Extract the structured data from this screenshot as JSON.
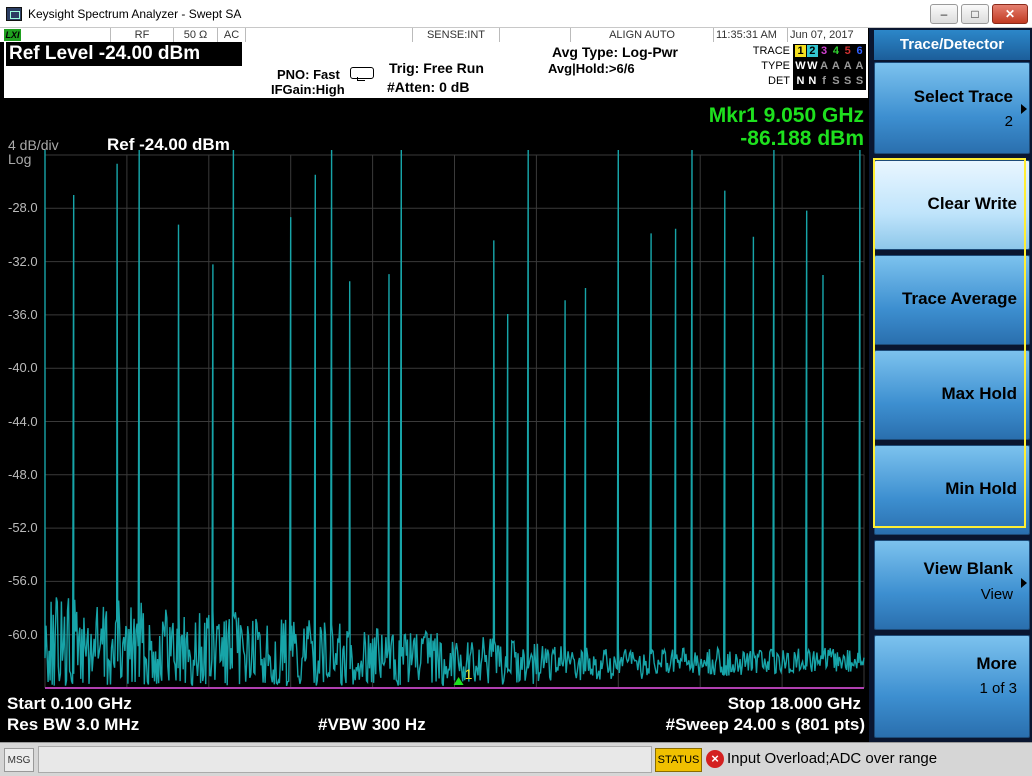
{
  "window": {
    "title": "Keysight Spectrum Analyzer - Swept SA",
    "min_glyph": "–",
    "max_glyph": "□",
    "close_glyph": "✕"
  },
  "status_row": {
    "lxi": "LXI",
    "rf": "RF",
    "impedance": "50 Ω",
    "coupling": "AC",
    "sense": "SENSE:INT",
    "align": "ALIGN AUTO",
    "time": "11:35:31 AM",
    "date": "Jun 07, 2017"
  },
  "header": {
    "ref_level": "Ref Level -24.00 dBm",
    "pno": "PNO: Fast",
    "ifgain": "IFGain:High",
    "trig": "Trig: Free Run",
    "atten": "#Atten: 0 dB",
    "avg_type": "Avg Type: Log-Pwr",
    "avg_hold": "Avg|Hold:>6/6",
    "trace_label": "TRACE",
    "type_label": "TYPE",
    "det_label": "DET",
    "trace_nums": [
      "1",
      "2",
      "3",
      "4",
      "5",
      "6"
    ],
    "trace_types": [
      "W",
      "W",
      "A",
      "A",
      "A",
      "A"
    ],
    "trace_dets": [
      "N",
      "N",
      "f",
      "S",
      "S",
      "S"
    ]
  },
  "marker": {
    "freq": "Mkr1 9.050 GHz",
    "amp": "-86.188 dBm",
    "label": "1"
  },
  "display": {
    "scale": "4 dB/div",
    "log": "Log",
    "ref": "Ref -24.00 dBm",
    "y_ticks": [
      "-28.0",
      "-32.0",
      "-36.0",
      "-40.0",
      "-44.0",
      "-48.0",
      "-52.0",
      "-56.0",
      "-60.0"
    ],
    "start": "Start 0.100 GHz",
    "stop": "Stop 18.000 GHz",
    "res_bw": "Res BW 3.0 MHz",
    "vbw": "#VBW 300 Hz",
    "sweep": "#Sweep  24.00 s (801 pts)"
  },
  "softkeys": {
    "panel_title": "Trace/Detector",
    "select_trace": "Select Trace",
    "select_trace_value": "2",
    "clear_write": "Clear Write",
    "trace_average": "Trace Average",
    "max_hold": "Max Hold",
    "min_hold": "Min Hold",
    "view_blank": "View Blank",
    "view_blank_value": "View",
    "more": "More",
    "more_value": "1 of 3"
  },
  "message": {
    "label": "MSG",
    "status": "STATUS",
    "error": "Input Overload;ADC over range"
  },
  "colors": {
    "trace": "#17a4a8",
    "marker_text": "#1ee01e",
    "graticule": "#3a3a3a",
    "trace_colors": [
      "#f5e020",
      "#34c6d0",
      "#d040d0",
      "#30d030",
      "#d03030",
      "#3060ff"
    ]
  }
}
